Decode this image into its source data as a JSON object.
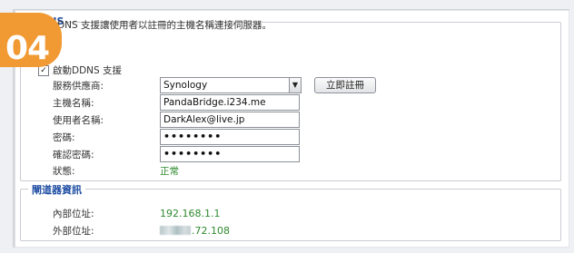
{
  "badge": {
    "step_number": "04"
  },
  "ddns_section": {
    "title": "DDNS",
    "description": "啟動DDNS 支援讓使用者以註冊的主機名稱連接伺服器。",
    "enable": {
      "label": "啟動DDNS 支援",
      "checked": true
    },
    "fields": {
      "provider": {
        "label": "服務供應商:",
        "value": "Synology"
      },
      "register_button": "立即註冊",
      "hostname": {
        "label": "主機名稱:",
        "value": "PandaBridge.i234.me"
      },
      "username": {
        "label": "使用者名稱:",
        "value": "DarkAlex@live.jp"
      },
      "password": {
        "label": "密碼:",
        "value": "••••••••"
      },
      "confirm_password": {
        "label": "確認密碼:",
        "value": "••••••••"
      },
      "status": {
        "label": "狀態:",
        "value": "正常"
      }
    }
  },
  "router_section": {
    "title": "閘道器資訊",
    "internal_ip": {
      "label": "內部位址:",
      "value": "192.168.1.1"
    },
    "external_ip": {
      "label": "外部位址:",
      "value_visible": ".72.108"
    }
  },
  "colors": {
    "badge": "#f19a34",
    "legend_text": "#1f4ea3",
    "status_green": "#2f8a2f"
  },
  "icons": {
    "checkbox_checked": "check-mark-icon",
    "select_arrow": "chevron-down-icon"
  }
}
